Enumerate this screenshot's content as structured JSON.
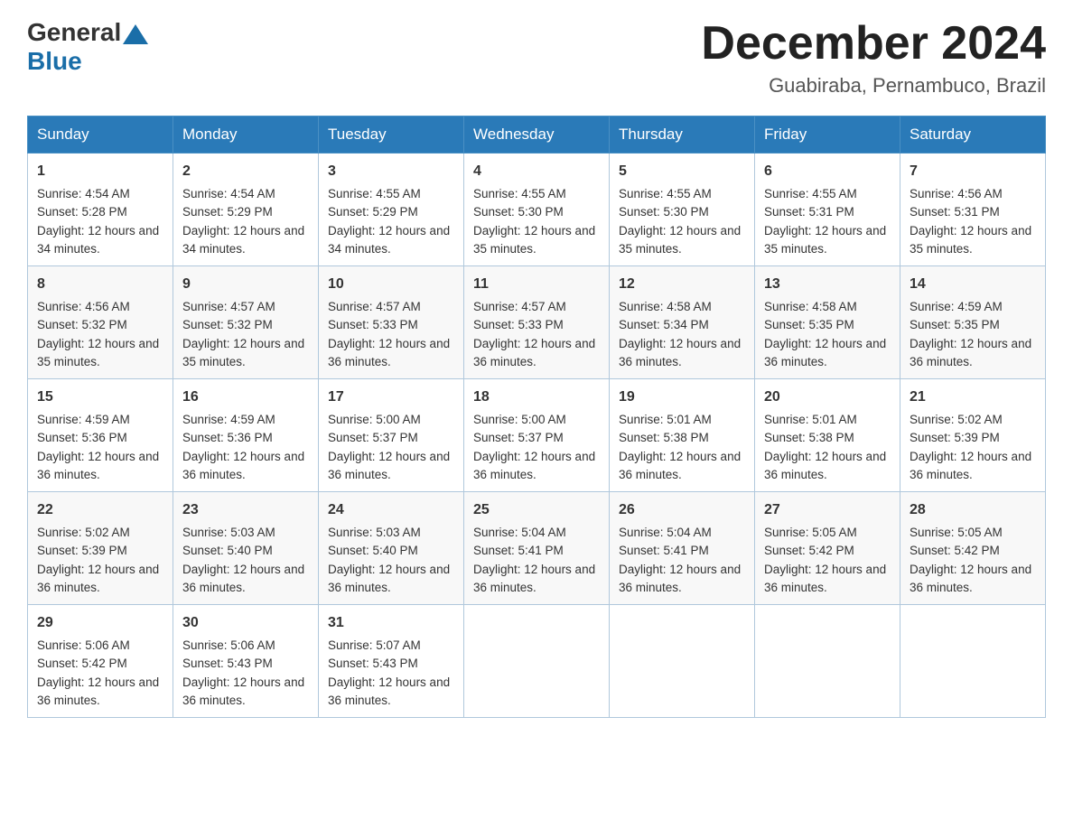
{
  "header": {
    "logo_general": "General",
    "logo_blue": "Blue",
    "month_title": "December 2024",
    "location": "Guabiraba, Pernambuco, Brazil"
  },
  "days_of_week": [
    "Sunday",
    "Monday",
    "Tuesday",
    "Wednesday",
    "Thursday",
    "Friday",
    "Saturday"
  ],
  "weeks": [
    [
      {
        "day": "1",
        "sunrise": "4:54 AM",
        "sunset": "5:28 PM",
        "daylight": "12 hours and 34 minutes."
      },
      {
        "day": "2",
        "sunrise": "4:54 AM",
        "sunset": "5:29 PM",
        "daylight": "12 hours and 34 minutes."
      },
      {
        "day": "3",
        "sunrise": "4:55 AM",
        "sunset": "5:29 PM",
        "daylight": "12 hours and 34 minutes."
      },
      {
        "day": "4",
        "sunrise": "4:55 AM",
        "sunset": "5:30 PM",
        "daylight": "12 hours and 35 minutes."
      },
      {
        "day": "5",
        "sunrise": "4:55 AM",
        "sunset": "5:30 PM",
        "daylight": "12 hours and 35 minutes."
      },
      {
        "day": "6",
        "sunrise": "4:55 AM",
        "sunset": "5:31 PM",
        "daylight": "12 hours and 35 minutes."
      },
      {
        "day": "7",
        "sunrise": "4:56 AM",
        "sunset": "5:31 PM",
        "daylight": "12 hours and 35 minutes."
      }
    ],
    [
      {
        "day": "8",
        "sunrise": "4:56 AM",
        "sunset": "5:32 PM",
        "daylight": "12 hours and 35 minutes."
      },
      {
        "day": "9",
        "sunrise": "4:57 AM",
        "sunset": "5:32 PM",
        "daylight": "12 hours and 35 minutes."
      },
      {
        "day": "10",
        "sunrise": "4:57 AM",
        "sunset": "5:33 PM",
        "daylight": "12 hours and 36 minutes."
      },
      {
        "day": "11",
        "sunrise": "4:57 AM",
        "sunset": "5:33 PM",
        "daylight": "12 hours and 36 minutes."
      },
      {
        "day": "12",
        "sunrise": "4:58 AM",
        "sunset": "5:34 PM",
        "daylight": "12 hours and 36 minutes."
      },
      {
        "day": "13",
        "sunrise": "4:58 AM",
        "sunset": "5:35 PM",
        "daylight": "12 hours and 36 minutes."
      },
      {
        "day": "14",
        "sunrise": "4:59 AM",
        "sunset": "5:35 PM",
        "daylight": "12 hours and 36 minutes."
      }
    ],
    [
      {
        "day": "15",
        "sunrise": "4:59 AM",
        "sunset": "5:36 PM",
        "daylight": "12 hours and 36 minutes."
      },
      {
        "day": "16",
        "sunrise": "4:59 AM",
        "sunset": "5:36 PM",
        "daylight": "12 hours and 36 minutes."
      },
      {
        "day": "17",
        "sunrise": "5:00 AM",
        "sunset": "5:37 PM",
        "daylight": "12 hours and 36 minutes."
      },
      {
        "day": "18",
        "sunrise": "5:00 AM",
        "sunset": "5:37 PM",
        "daylight": "12 hours and 36 minutes."
      },
      {
        "day": "19",
        "sunrise": "5:01 AM",
        "sunset": "5:38 PM",
        "daylight": "12 hours and 36 minutes."
      },
      {
        "day": "20",
        "sunrise": "5:01 AM",
        "sunset": "5:38 PM",
        "daylight": "12 hours and 36 minutes."
      },
      {
        "day": "21",
        "sunrise": "5:02 AM",
        "sunset": "5:39 PM",
        "daylight": "12 hours and 36 minutes."
      }
    ],
    [
      {
        "day": "22",
        "sunrise": "5:02 AM",
        "sunset": "5:39 PM",
        "daylight": "12 hours and 36 minutes."
      },
      {
        "day": "23",
        "sunrise": "5:03 AM",
        "sunset": "5:40 PM",
        "daylight": "12 hours and 36 minutes."
      },
      {
        "day": "24",
        "sunrise": "5:03 AM",
        "sunset": "5:40 PM",
        "daylight": "12 hours and 36 minutes."
      },
      {
        "day": "25",
        "sunrise": "5:04 AM",
        "sunset": "5:41 PM",
        "daylight": "12 hours and 36 minutes."
      },
      {
        "day": "26",
        "sunrise": "5:04 AM",
        "sunset": "5:41 PM",
        "daylight": "12 hours and 36 minutes."
      },
      {
        "day": "27",
        "sunrise": "5:05 AM",
        "sunset": "5:42 PM",
        "daylight": "12 hours and 36 minutes."
      },
      {
        "day": "28",
        "sunrise": "5:05 AM",
        "sunset": "5:42 PM",
        "daylight": "12 hours and 36 minutes."
      }
    ],
    [
      {
        "day": "29",
        "sunrise": "5:06 AM",
        "sunset": "5:42 PM",
        "daylight": "12 hours and 36 minutes."
      },
      {
        "day": "30",
        "sunrise": "5:06 AM",
        "sunset": "5:43 PM",
        "daylight": "12 hours and 36 minutes."
      },
      {
        "day": "31",
        "sunrise": "5:07 AM",
        "sunset": "5:43 PM",
        "daylight": "12 hours and 36 minutes."
      },
      null,
      null,
      null,
      null
    ]
  ],
  "labels": {
    "sunrise": "Sunrise:",
    "sunset": "Sunset:",
    "daylight": "Daylight:"
  }
}
